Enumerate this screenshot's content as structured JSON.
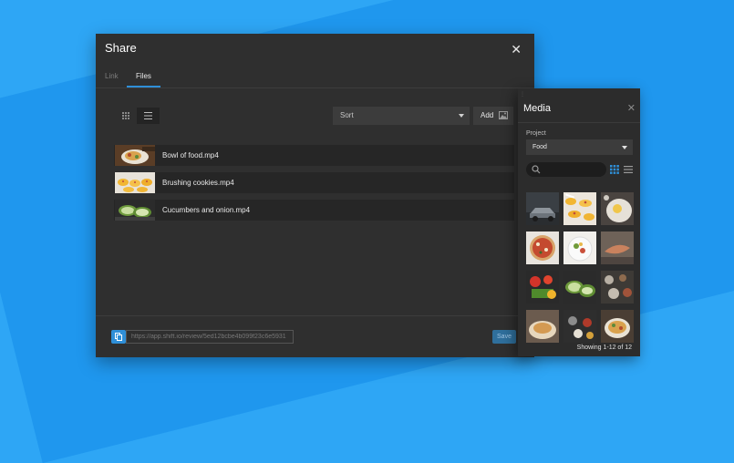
{
  "share": {
    "title": "Share",
    "tabs": [
      {
        "label": "Link",
        "active": false
      },
      {
        "label": "Files",
        "active": true
      }
    ],
    "sort_label": "Sort",
    "add_label": "Add",
    "files": [
      {
        "name": "Bowl of food.mp4",
        "thumb": "pancake-dish"
      },
      {
        "name": "Brushing cookies.mp4",
        "thumb": "cookies"
      },
      {
        "name": "Cucumbers and onion.mp4",
        "thumb": "cucumbers"
      }
    ],
    "url_value": "https://app.shift.io/review/5ed12bcbe4b099f23c6e5931",
    "save_label": "Save"
  },
  "media": {
    "title": "Media",
    "project_label": "Project",
    "project_value": "Food",
    "search_placeholder": "",
    "items": [
      "car",
      "cookies",
      "flour",
      "pizza",
      "salad-plate",
      "fish",
      "vegetables",
      "cucumbers",
      "spices",
      "pancakes",
      "spoons",
      "bowl"
    ],
    "showing_text": "Showing 1-12 of 12"
  },
  "colors": {
    "accent": "#2f8fd8",
    "background": "#2ea6f5",
    "panel": "#2f2f2f"
  }
}
